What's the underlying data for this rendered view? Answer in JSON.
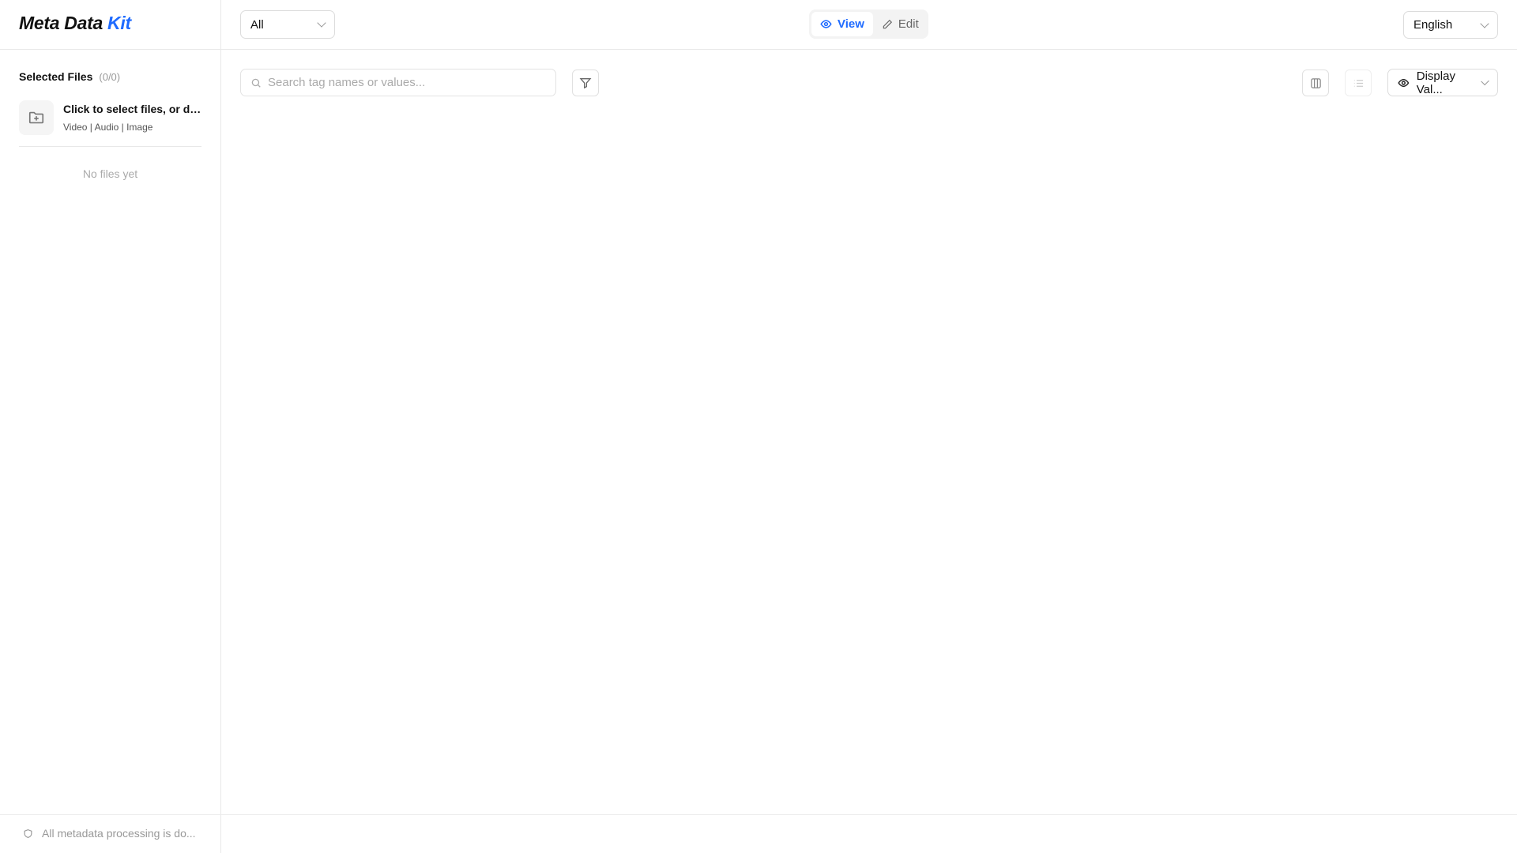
{
  "logo": {
    "main": "Meta Data ",
    "accent": "Kit"
  },
  "header": {
    "filter_select": "All",
    "mode": {
      "view": "View",
      "edit": "Edit"
    },
    "language": "English"
  },
  "toolbar": {
    "search_placeholder": "Search tag names or values...",
    "display_select": "Display Val..."
  },
  "sidebar": {
    "title": "Selected Files",
    "count": "(0/0)",
    "upload_title": "Click to select files, or dra...",
    "upload_types": "Video | Audio | Image",
    "empty": "No files yet"
  },
  "footer": {
    "text": "All metadata processing is do..."
  },
  "colors": {
    "accent": "#1f6bff"
  }
}
